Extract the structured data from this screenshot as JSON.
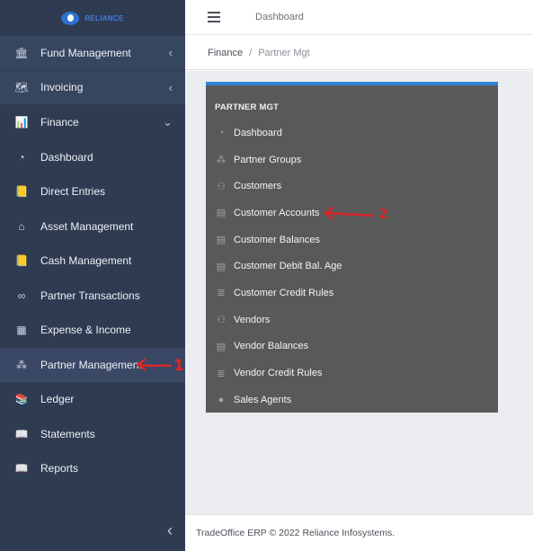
{
  "logo": {
    "text": "RELIANCE"
  },
  "sidebar": {
    "items": [
      {
        "label": "Fund Management",
        "icon": "bank-icon",
        "glyph": "🏛",
        "caret": "‹"
      },
      {
        "label": "Invoicing",
        "icon": "map-icon",
        "glyph": "🗺",
        "caret": "‹"
      },
      {
        "label": "Finance",
        "icon": "chart-icon",
        "glyph": "📊",
        "caret": "⌄"
      },
      {
        "label": "Dashboard",
        "icon": "gauge-icon",
        "glyph": "◔"
      },
      {
        "label": "Direct Entries",
        "icon": "journal-icon",
        "glyph": "📒"
      },
      {
        "label": "Asset Management",
        "icon": "house-icon",
        "glyph": "⌂"
      },
      {
        "label": "Cash Management",
        "icon": "cash-icon",
        "glyph": "📒"
      },
      {
        "label": "Partner Transactions",
        "icon": "link-icon",
        "glyph": "∞"
      },
      {
        "label": "Expense & Income",
        "icon": "calculator-icon",
        "glyph": "▦"
      },
      {
        "label": "Partner Management",
        "icon": "people-icon",
        "glyph": "⁂"
      },
      {
        "label": "Ledger",
        "icon": "ledger-icon",
        "glyph": "📚"
      },
      {
        "label": "Statements",
        "icon": "book-icon",
        "glyph": "📖"
      },
      {
        "label": "Reports",
        "icon": "book-icon",
        "glyph": "📖"
      }
    ],
    "collapse_glyph": "‹"
  },
  "topbar": {
    "title": "Dashboard"
  },
  "breadcrumb": {
    "parent": "Finance",
    "separator": "/",
    "current": "Partner Mgt"
  },
  "panel": {
    "heading": "PARTNER MGT",
    "items": [
      {
        "label": "Dashboard",
        "icon": "gauge-icon",
        "glyph": "◔"
      },
      {
        "label": "Partner Groups",
        "icon": "group-icon",
        "glyph": "⁂"
      },
      {
        "label": "Customers",
        "icon": "customers-icon",
        "glyph": "⚇"
      },
      {
        "label": "Customer Accounts",
        "icon": "account-icon",
        "glyph": "▤"
      },
      {
        "label": "Customer Balances",
        "icon": "balance-icon",
        "glyph": "▤"
      },
      {
        "label": "Customer Debit Bal. Age",
        "icon": "aging-icon",
        "glyph": "▤"
      },
      {
        "label": "Customer Credit Rules",
        "icon": "rules-icon",
        "glyph": "≣"
      },
      {
        "label": "Vendors",
        "icon": "vendors-icon",
        "glyph": "⚇"
      },
      {
        "label": "Vendor Balances",
        "icon": "balance-icon",
        "glyph": "▤"
      },
      {
        "label": "Vendor Credit Rules",
        "icon": "rules-icon",
        "glyph": "≣"
      },
      {
        "label": "Sales Agents",
        "icon": "agent-icon",
        "glyph": "●"
      }
    ]
  },
  "footer": {
    "text": "TradeOffice ERP © 2022 Reliance Infosystems."
  },
  "annotations": {
    "first": "1",
    "second": "2",
    "color": "#d9262a"
  },
  "colors": {
    "sidebar": "#2f3b51",
    "panel": "#585959",
    "accent": "#2f86d8"
  }
}
